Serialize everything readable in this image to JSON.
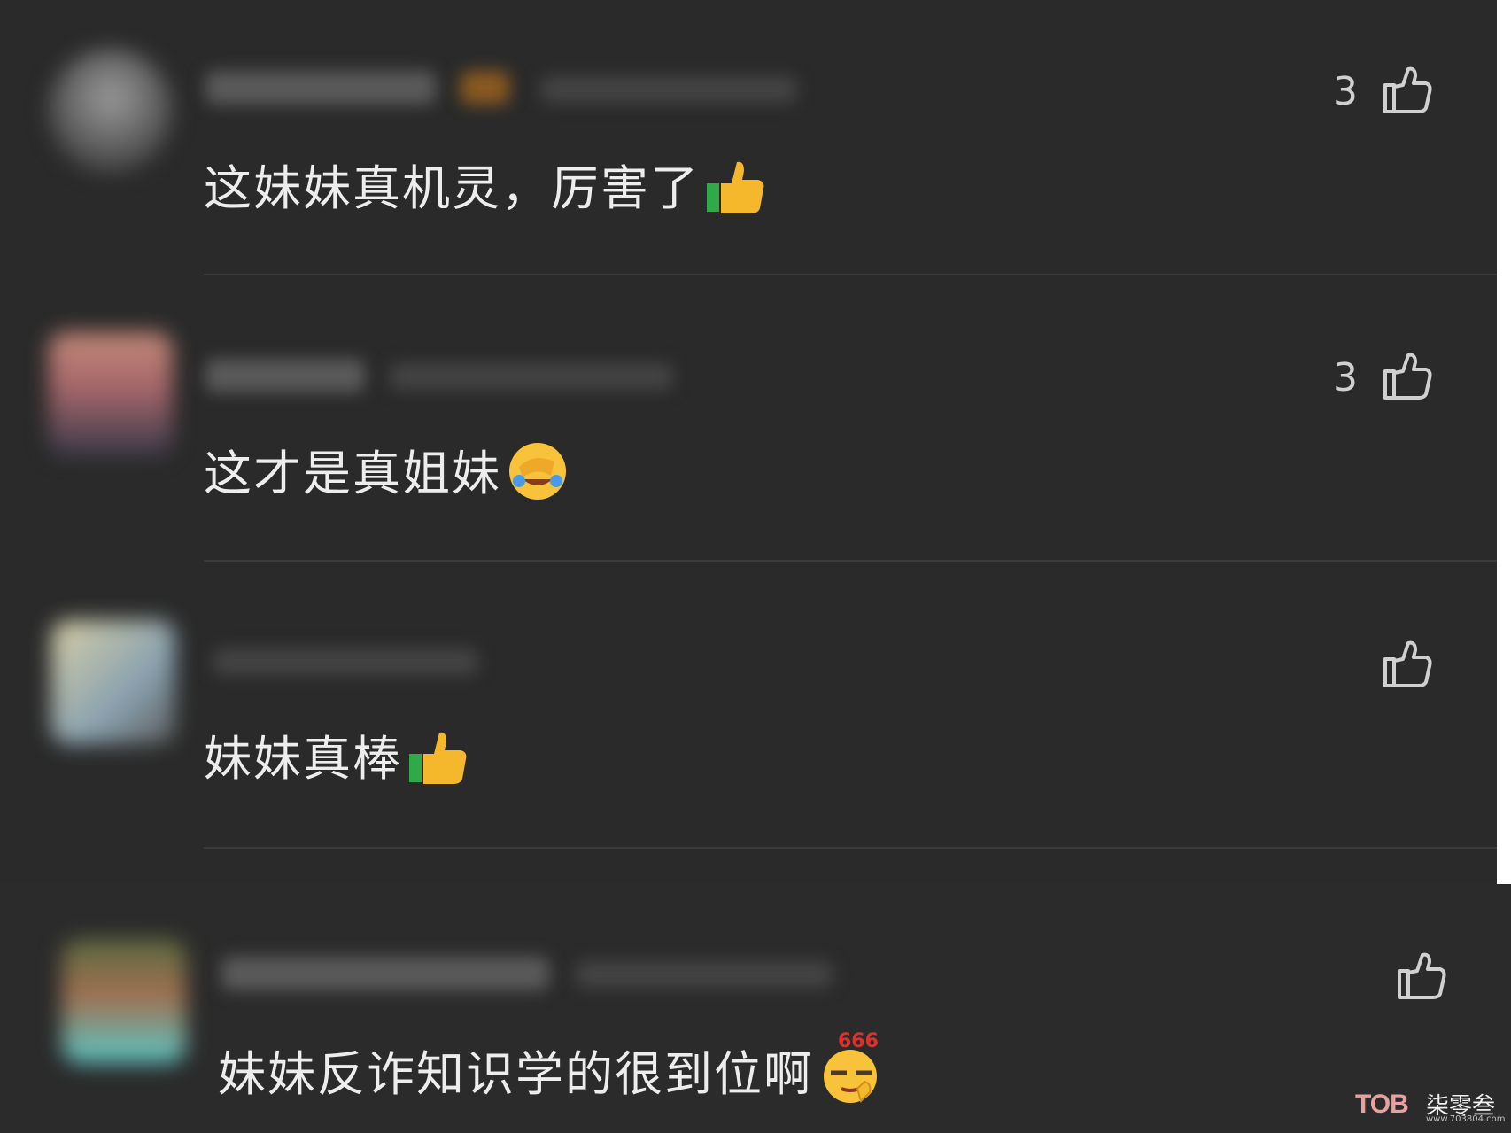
{
  "comments": [
    {
      "text": "这妹妹真机灵，厉害了",
      "emoji": "thumbs-up-emoji",
      "likes": "3"
    },
    {
      "text": "这才是真姐妹",
      "emoji": "facepalm-laugh-emoji",
      "likes": "3"
    },
    {
      "text": "妹妹真棒",
      "emoji": "thumbs-up-emoji",
      "likes": ""
    },
    {
      "text": "妹妹反诈知识学的很到位啊",
      "emoji": "666-emoji",
      "emoji_text": "666",
      "likes": ""
    }
  ],
  "icons": {
    "like": "thumbs-up-outline-icon"
  },
  "watermark": {
    "brand": "TOB",
    "text": "柒零叁",
    "url": "www.703804.com"
  },
  "colors": {
    "background": "#2a2a2a",
    "text": "#ededed",
    "divider": "#3b3b3b",
    "icon": "#d0d0d0"
  }
}
